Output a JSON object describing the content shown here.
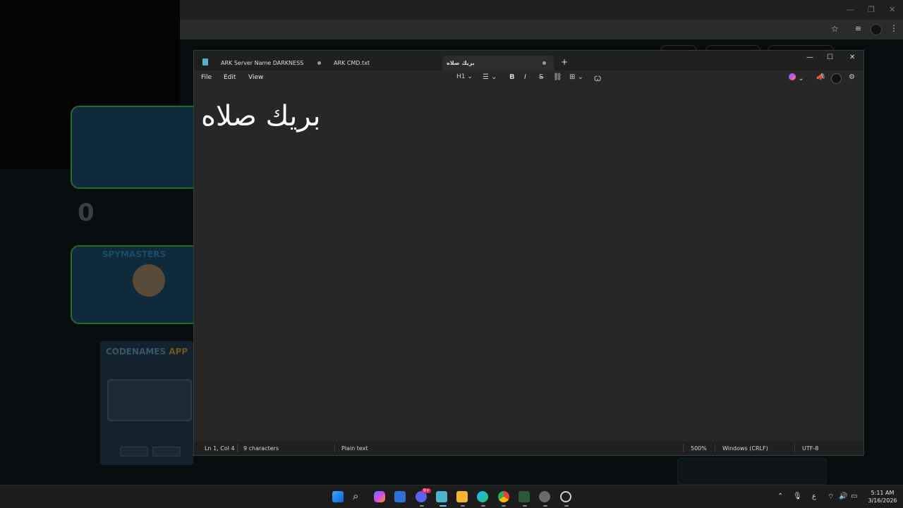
{
  "notepad": {
    "tabs": [
      {
        "label": "ARK Server Name  DARKNESS"
      },
      {
        "label": "ARK CMD.txt"
      },
      {
        "label": "بريك صلاه"
      }
    ],
    "new_tab_glyph": "+",
    "window_controls": {
      "minimize": "—",
      "maximize": "☐",
      "close": "✕"
    },
    "menu": {
      "file": "File",
      "edit": "Edit",
      "view": "View"
    },
    "toolbar": {
      "heading": "H1",
      "bold": "B",
      "italic": "I",
      "strikethrough": "S"
    },
    "content": "بريك صلاه",
    "status": {
      "position": "Ln 1, Col 4",
      "characters": "9 characters",
      "format": "Plain text",
      "zoom": "500%",
      "line_ending": "Windows (CRLF)",
      "encoding": "UTF-8"
    }
  },
  "background": {
    "score": "0",
    "team_title": "SPYMASTERS",
    "app_title_main": "CODENAMES",
    "app_title_accent": " APP"
  },
  "taskbar": {
    "language": "ع",
    "time": "5:11 AM",
    "date": "3/16/2026",
    "discord_badge": "9+"
  },
  "colors": {
    "notepad_bg": "#272727",
    "accent_green": "#2b6a22",
    "taskbar_bg": "#1c1c1c"
  }
}
